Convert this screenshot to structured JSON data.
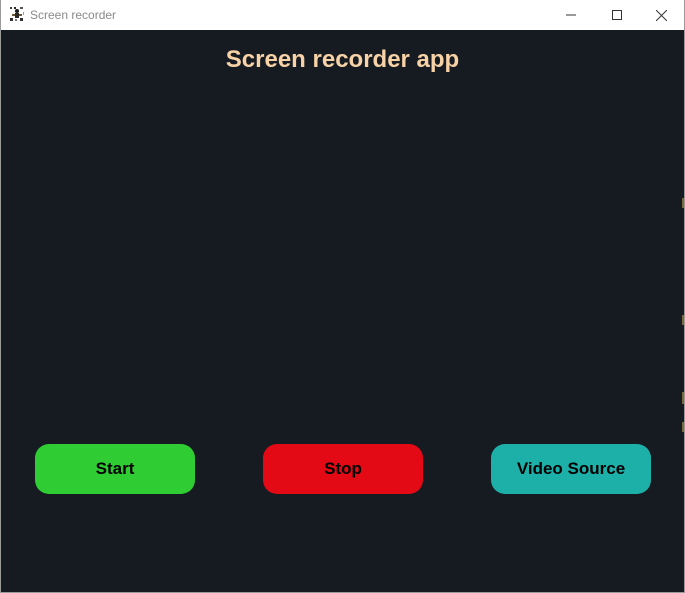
{
  "window": {
    "title": "Screen recorder",
    "icon": "recorder-app-icon",
    "controls": {
      "minimize_icon": "minimize-icon",
      "maximize_icon": "maximize-icon",
      "close_icon": "close-icon"
    }
  },
  "app": {
    "heading": "Screen recorder app",
    "background_color": "#161a21",
    "heading_color": "#f6d2a6"
  },
  "buttons": {
    "start": {
      "label": "Start",
      "color": "#2fcd33"
    },
    "stop": {
      "label": "Stop",
      "color": "#e30915"
    },
    "video_source": {
      "label": "Video Source",
      "color": "#1cb0a9"
    }
  }
}
